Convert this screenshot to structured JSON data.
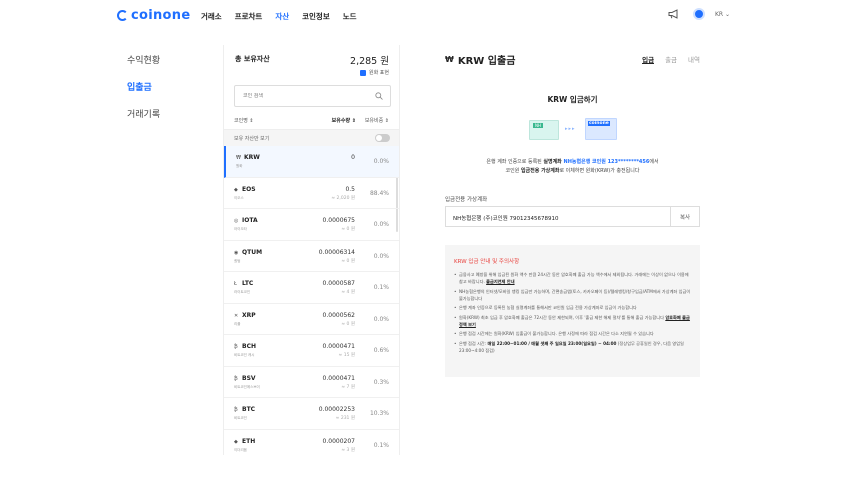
{
  "header": {
    "logo": "coinone",
    "nav": [
      "거래소",
      "프로차트",
      "자산",
      "코인정보",
      "노드"
    ],
    "active_nav": "자산",
    "lang": "KR ⌄",
    "icons": [
      "megaphone-icon",
      "avatar"
    ]
  },
  "leftmenu": {
    "items": [
      "수익현황",
      "입출금",
      "거래기록"
    ],
    "active": "입출금"
  },
  "assets": {
    "total_label": "총 보유자산",
    "total_value": "2,285 원",
    "krw_conversion": "원화 표현",
    "search_placeholder": "코인 검색",
    "col_name": "코인명 ⇕",
    "col_balance": "보유수량 ⇕",
    "col_ratio": "보유비중 ⇕",
    "holdings_only": "보유 자산만 보기",
    "coins": [
      {
        "icon": "₩",
        "symbol": "KRW",
        "name": "원화",
        "balance": "0",
        "sub": "",
        "ratio": "0.0%"
      },
      {
        "icon": "◆",
        "symbol": "EOS",
        "name": "이오스",
        "balance": "0.5",
        "sub": "≈ 2,020 원",
        "ratio": "88.4%"
      },
      {
        "icon": "◎",
        "symbol": "IOTA",
        "name": "아이오타",
        "balance": "0.0000675",
        "sub": "≈ 0 원",
        "ratio": "0.0%"
      },
      {
        "icon": "◉",
        "symbol": "QTUM",
        "name": "퀀텀",
        "balance": "0.00006314",
        "sub": "≈ 0 원",
        "ratio": "0.0%"
      },
      {
        "icon": "Ł",
        "symbol": "LTC",
        "name": "라이트코인",
        "balance": "0.0000587",
        "sub": "≈ 4 원",
        "ratio": "0.1%"
      },
      {
        "icon": "✕",
        "symbol": "XRP",
        "name": "리플",
        "balance": "0.0000562",
        "sub": "≈ 0 원",
        "ratio": "0.0%"
      },
      {
        "icon": "₿",
        "symbol": "BCH",
        "name": "비트코인 캐시",
        "balance": "0.0000471",
        "sub": "≈ 15 원",
        "ratio": "0.6%"
      },
      {
        "icon": "₿",
        "symbol": "BSV",
        "name": "비트코인에스브이",
        "balance": "0.0000471",
        "sub": "≈ 7 원",
        "ratio": "0.3%"
      },
      {
        "icon": "₿",
        "symbol": "BTC",
        "name": "비트코인",
        "balance": "0.00002253",
        "sub": "≈ 231 원",
        "ratio": "10.3%"
      },
      {
        "icon": "◆",
        "symbol": "ETH",
        "name": "이더리움",
        "balance": "0.0000207",
        "sub": "≈ 3 원",
        "ratio": "0.1%"
      }
    ]
  },
  "right": {
    "title": "KRW 입출금",
    "tabs": [
      "입금",
      "출금",
      "내역"
    ],
    "active_tab": "입금",
    "deposit_title": "KRW 입금하기",
    "card_nh": "NH",
    "card_arrows": "▸▸▸",
    "card_coinone": "coinone",
    "desc": {
      "l1a": "은행 계좌 인증으로 등록된 ",
      "l1b": "실명계좌",
      "l1c": " NH농협은행 코인원 123********456",
      "l1d": "에서",
      "l2a": "코인원 ",
      "l2b": "입금전용 가상계좌",
      "l2c": "로 이체하면 원화(KRW)가 충전됩니다"
    },
    "account_label": "입금전용 가상계좌",
    "account_value": "NH농협은행 (주)코인원 79012345678910",
    "copy_label": "복사",
    "notice_title": "KRW 입금 안내 및 주의사항",
    "notice": {
      "n1": "금융사고 예방을 위해 입금된 원화 액수 만큼 24시간 동안 암호화폐 출금 가능 액수에서 제외됩니다. 거래에는 이상이 없으나 이용에 참고 바랍니다.",
      "n1_link": "출금지연제 안내",
      "n2": "NH농협은행의 인터넷/모바일 뱅킹 입금만 가능하며, 간편송금앱(토스, 카카오페이 등)/텔레뱅킹/창구입금/ATM에서 가상계좌 입금이 불가능합니다",
      "n3": "은행 계좌 인증으로 등록된 농협 실명계좌를 통해서만 코인원 입금 전용 가상계좌로 입금이 가능합니다",
      "n4": "원화(KRW) 최초 입금 후 암호화폐 출금은 72시간 동안 제한되며, 이후 '출금 제한 해제 절차'를 통해 출금 가능합니다",
      "n4_link": "암호화폐 출금정책 보기",
      "n5": "은행 점검 시간에는 원화(KRW) 입출금이 불가능합니다. 은행 사정에 따라 점검 시간은 다소 지연될 수 있습니다",
      "n6a": "은행 점검 시간: ",
      "n6b": "매일 22:00~01:00 / 매월 셋째 주 일요일 23:00(일요일) ~ 04:00",
      "n6c": "(정상업무 공휴일인 경우, 다음 영업일 23:00~4:00 점검)"
    }
  }
}
